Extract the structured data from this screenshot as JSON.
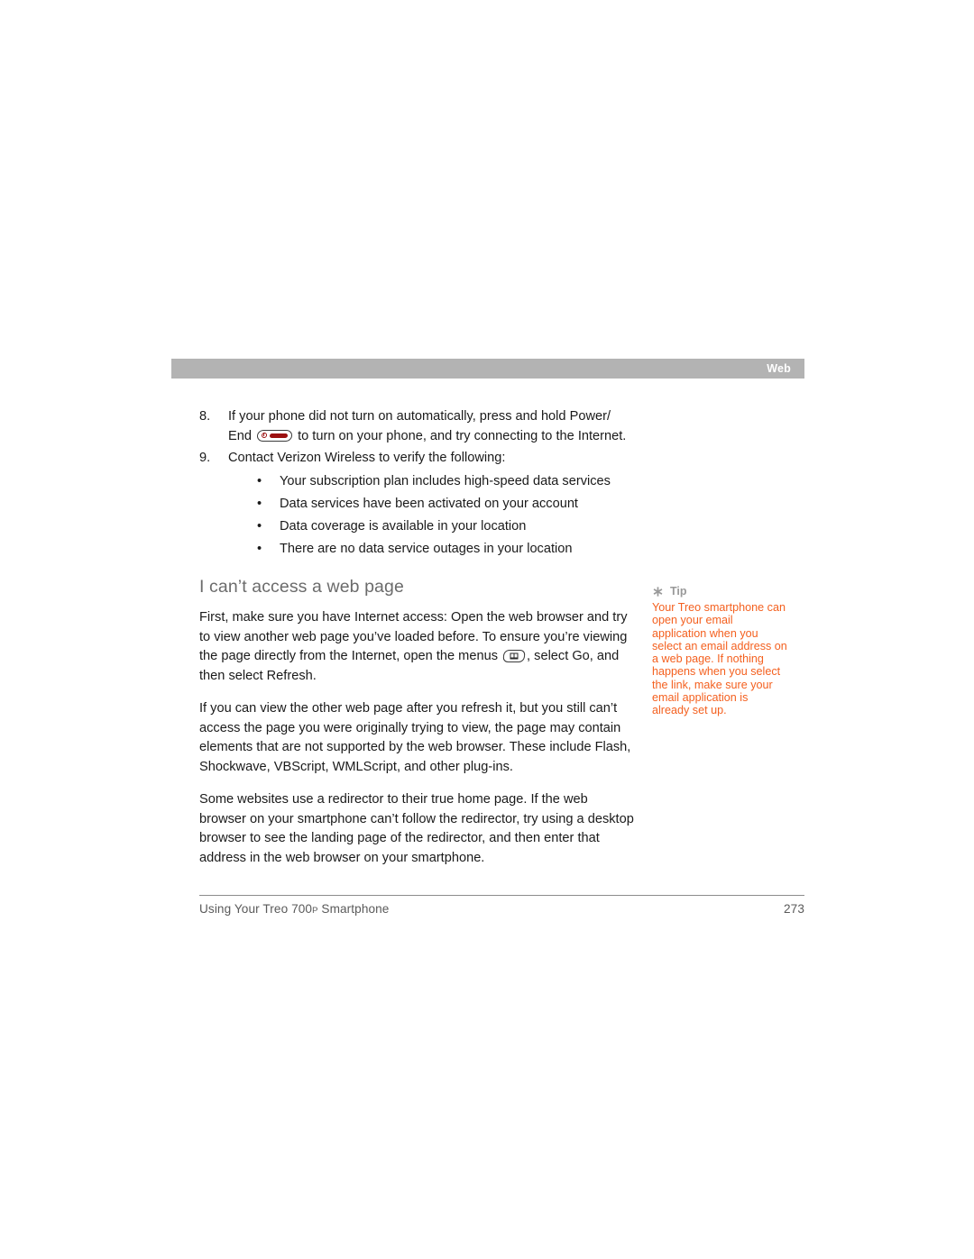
{
  "header": {
    "section_label": "Web"
  },
  "steps": [
    {
      "number": "8.",
      "text_before_icon": "If your phone did not turn on automatically, press and hold Power/ End ",
      "icon": "power-end-key-icon",
      "text_after_icon": " to turn on your phone, and try connecting to the Internet."
    },
    {
      "number": "9.",
      "text_before_icon": "Contact Verizon Wireless to verify the following:",
      "icon": "",
      "text_after_icon": ""
    }
  ],
  "bullets": [
    {
      "marker": "•",
      "text": "Your subscription plan includes high-speed data services"
    },
    {
      "marker": "•",
      "text": "Data services have been activated on your account"
    },
    {
      "marker": "•",
      "text": "Data coverage is available in your location"
    },
    {
      "marker": "•",
      "text": "There are no data service outages in your location"
    }
  ],
  "section": {
    "heading": "I can’t access a web page",
    "para1_before_icon": "First, make sure you have Internet access: Open the web browser and try to view another web page you’ve loaded before. To ensure you’re viewing the page directly from the Internet, open the menus ",
    "para1_icon": "menu-key-icon",
    "para1_after_icon": ", select Go, and then select Refresh.",
    "para2": "If you can view the other web page after you refresh it, but you still can’t access the page you were originally trying to view, the page may contain elements that are not supported by the web browser. These include Flash, Shockwave, VBScript, WMLScript, and other plug-ins.",
    "para3": "Some websites use a redirector to their true home page. If the web browser on your smartphone can’t follow the redirector, try using a desktop browser to see the landing page of the redirector, and then enter that address in the web browser on your smartphone."
  },
  "tip": {
    "icon": "asterisk-icon",
    "label": "Tip",
    "text": "Your Treo smartphone can open your email application when you select an email address on a web page. If nothing happens when you select the link, make sure your email application is already set up."
  },
  "footer": {
    "title_part1": "Using Your Treo 700",
    "title_smallcap": "P",
    "title_part2": " Smartphone",
    "page_number": "273"
  },
  "colors": {
    "header_bar": "#b3b3b3",
    "header_text": "#ffffff",
    "heading_text": "#6b6b6b",
    "body_text": "#1a1a1a",
    "tip_text": "#f4601f",
    "tip_label": "#999999",
    "footer_text": "#5a5a5a",
    "key_accent_red": "#9c1010"
  }
}
